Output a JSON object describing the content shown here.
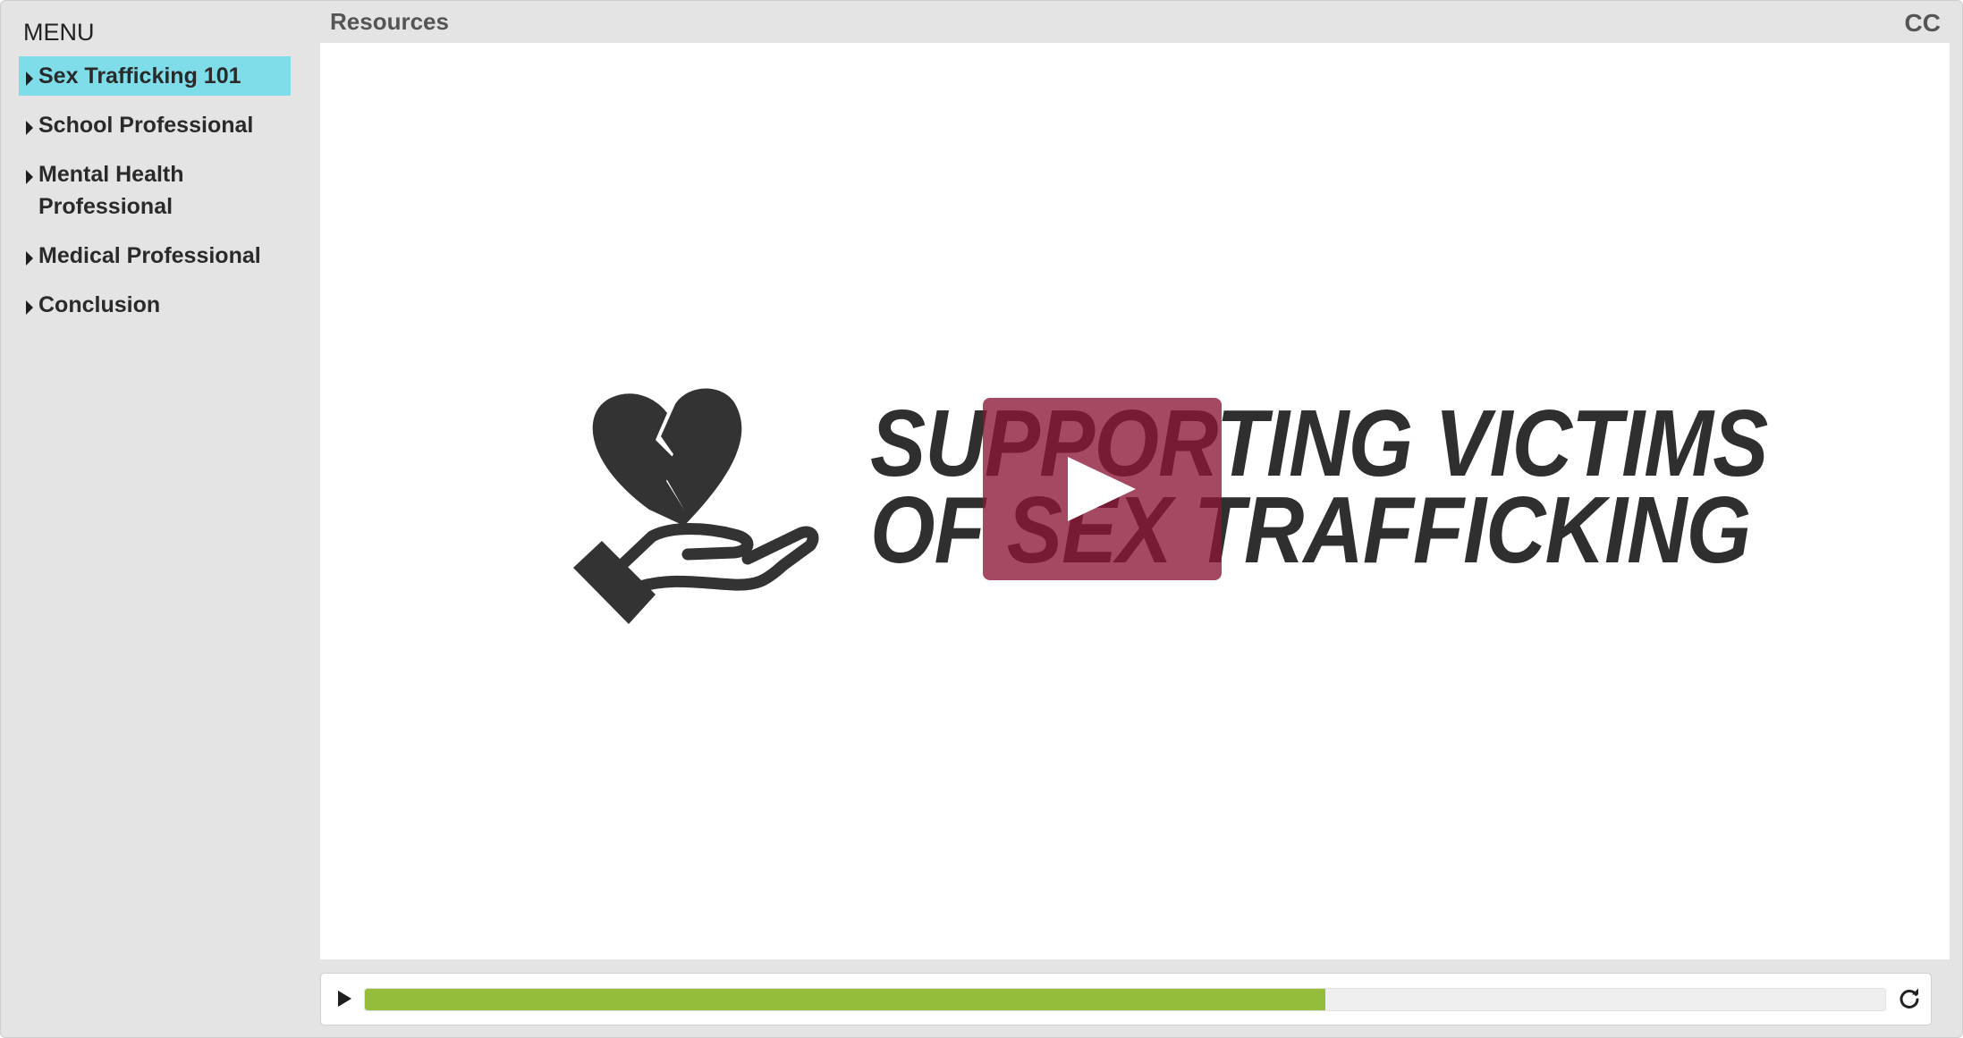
{
  "sidebar": {
    "title": "MENU",
    "items": [
      {
        "label": "Sex Trafficking 101",
        "active": true
      },
      {
        "label": "School Professional",
        "active": false
      },
      {
        "label": "Mental Health Professional",
        "active": false
      },
      {
        "label": "Medical Professional",
        "active": false
      },
      {
        "label": "Conclusion",
        "active": false
      }
    ]
  },
  "topbar": {
    "resources_label": "Resources",
    "cc_label": "CC"
  },
  "slide": {
    "title_line1": "SUPPORTING VICTIMS",
    "title_line2": "OF SEX TRAFFICKING",
    "icon": "broken-heart-in-hand-icon",
    "play_overlay_icon": "play-icon"
  },
  "playbar": {
    "progress": 0.632,
    "play_icon": "play-icon",
    "replay_icon": "replay-icon"
  },
  "colors": {
    "active_menu_bg": "#7fdde9",
    "progress_fill": "#94bd3c",
    "play_overlay": "#8a1634",
    "title_text": "#2f2f2f",
    "app_bg": "#e4e4e4"
  }
}
